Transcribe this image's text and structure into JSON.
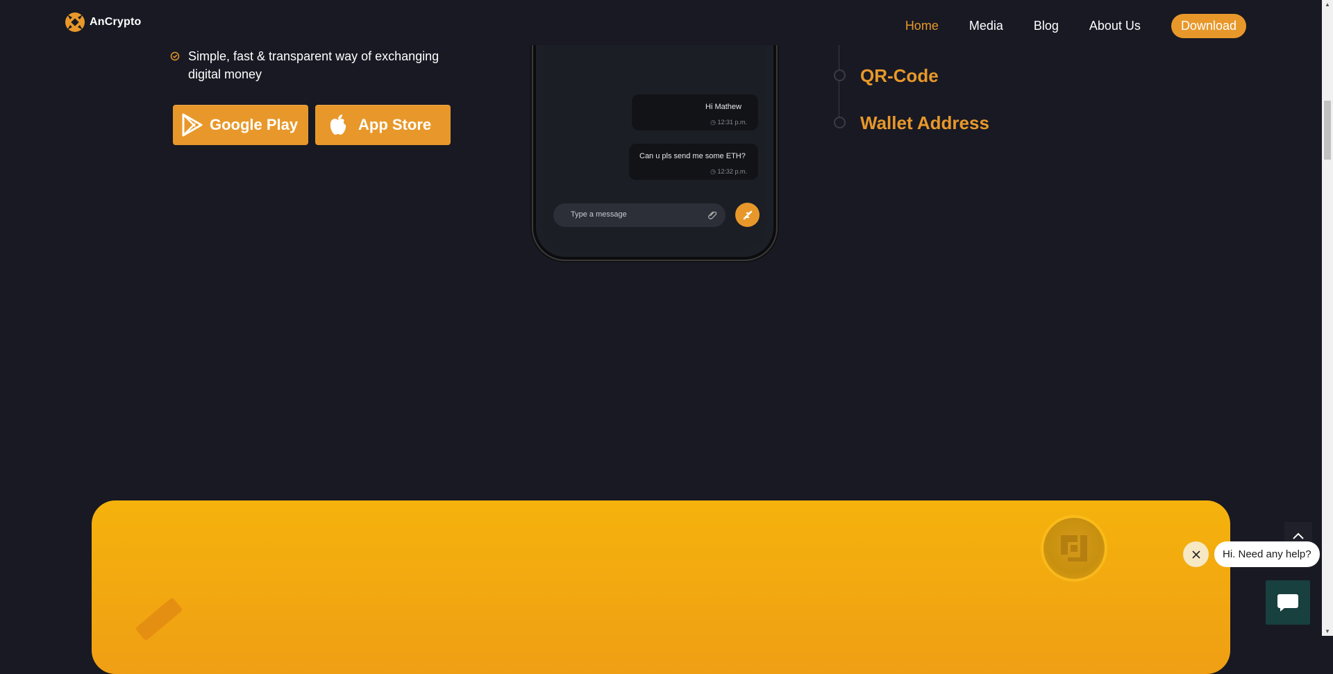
{
  "brand": {
    "name": "AnCrypto"
  },
  "nav": {
    "items": [
      {
        "label": "Home",
        "active": true
      },
      {
        "label": "Media",
        "active": false
      },
      {
        "label": "Blog",
        "active": false
      },
      {
        "label": "About Us",
        "active": false
      }
    ],
    "download_label": "Download"
  },
  "features": {
    "item": "Simple, fast & transparent way of exchanging digital money"
  },
  "store_buttons": {
    "google_play": "Google Play",
    "app_store": "App Store"
  },
  "phone_chat": {
    "messages": [
      {
        "text": "Hi Mathew",
        "time": "12:31 p.m."
      },
      {
        "text": "Can u pls send me some ETH?",
        "time": "12:32 p.m."
      }
    ],
    "input_placeholder": "Type a message"
  },
  "timeline": {
    "items": [
      "QR-Code",
      "Wallet Address"
    ]
  },
  "chat_widget": {
    "greeting": "Hi. Need any help?"
  },
  "colors": {
    "background": "#181923",
    "accent": "#e8982a",
    "banner": "#f5b20c",
    "chat_button": "#17403f"
  }
}
